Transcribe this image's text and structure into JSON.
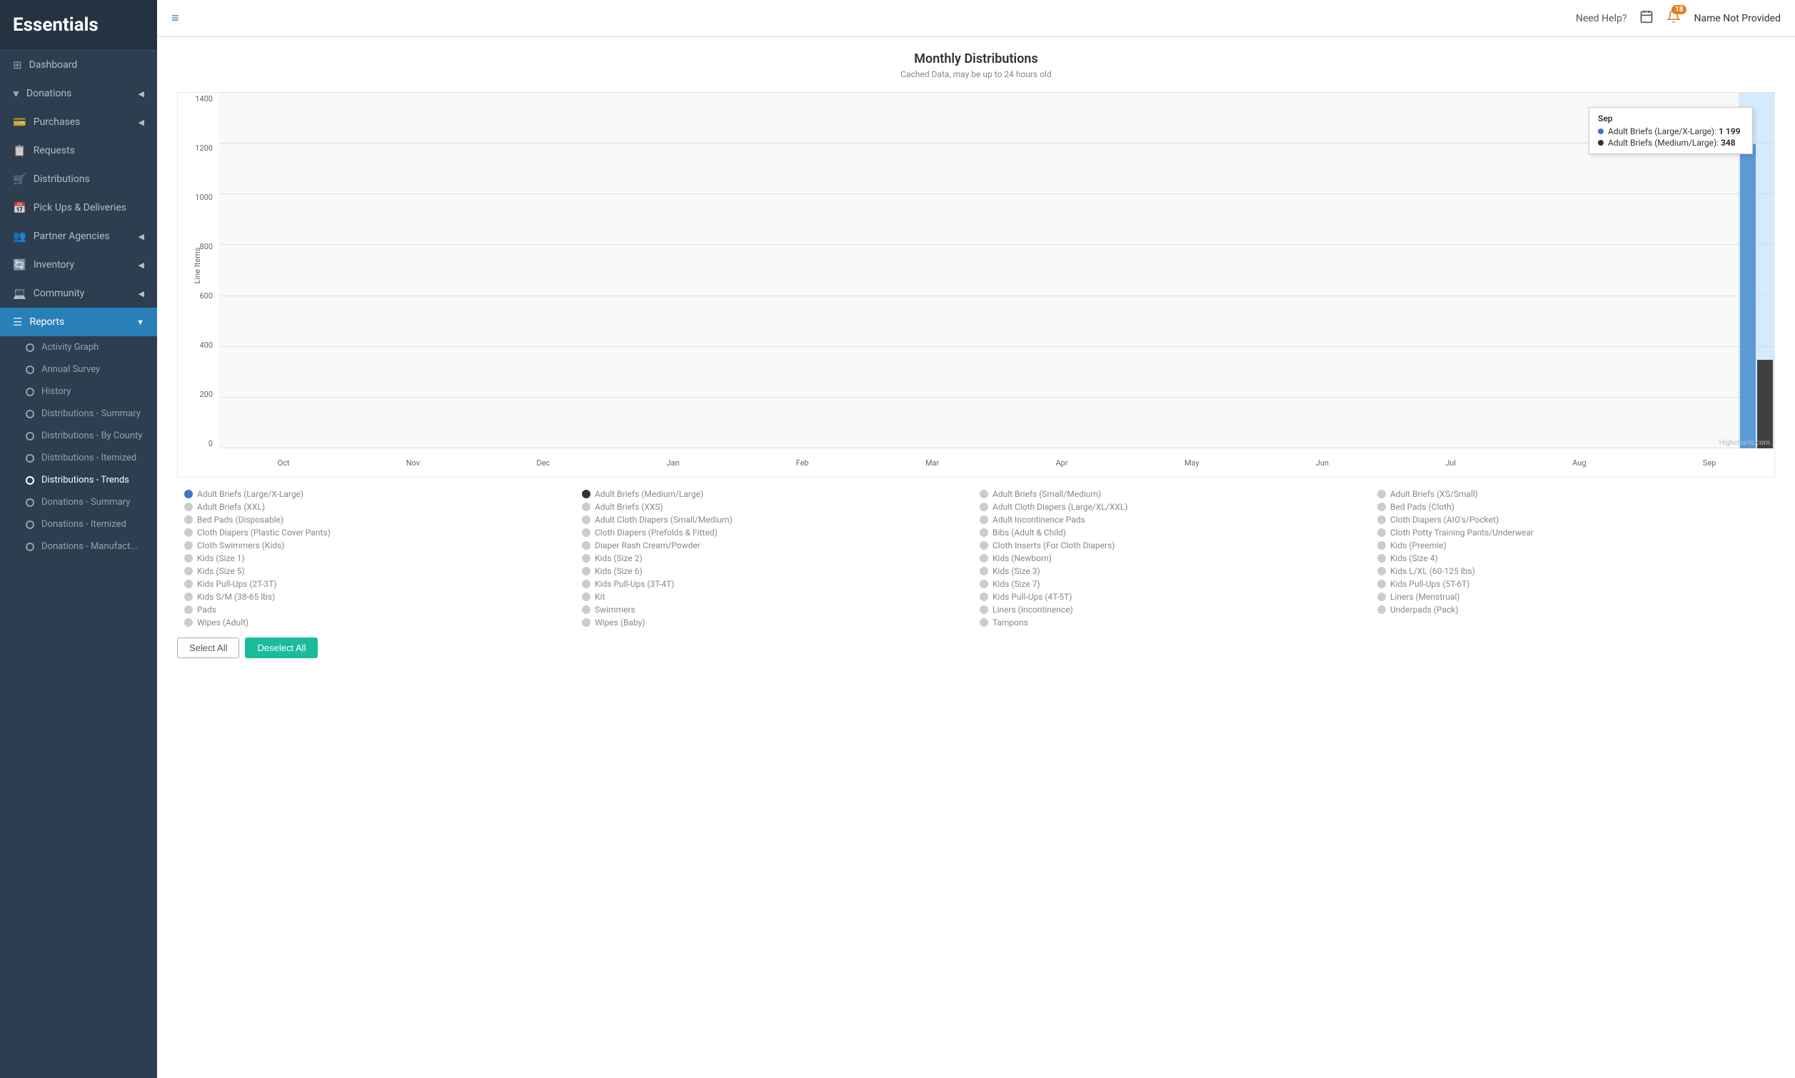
{
  "brand": "Essentials",
  "topbar": {
    "hamburger_icon": "≡",
    "help_text": "Need Help?",
    "calendar_icon": "📅",
    "bell_icon": "🔔",
    "notification_count": "18",
    "username": "Name Not Provided"
  },
  "sidebar": {
    "items": [
      {
        "id": "dashboard",
        "label": "Dashboard",
        "icon": "⊞",
        "has_chevron": false,
        "active": false
      },
      {
        "id": "donations",
        "label": "Donations",
        "icon": "♥",
        "has_chevron": true,
        "active": false
      },
      {
        "id": "purchases",
        "label": "Purchases",
        "icon": "💳",
        "has_chevron": true,
        "active": false
      },
      {
        "id": "requests",
        "label": "Requests",
        "icon": "📋",
        "has_chevron": false,
        "active": false
      },
      {
        "id": "distributions",
        "label": "Distributions",
        "icon": "🛒",
        "has_chevron": false,
        "active": false
      },
      {
        "id": "pickups",
        "label": "Pick Ups & Deliveries",
        "icon": "📅",
        "has_chevron": false,
        "active": false
      },
      {
        "id": "partner-agencies",
        "label": "Partner Agencies",
        "icon": "👥",
        "has_chevron": true,
        "active": false
      },
      {
        "id": "inventory",
        "label": "Inventory",
        "icon": "🔄",
        "has_chevron": true,
        "active": false
      },
      {
        "id": "community",
        "label": "Community",
        "icon": "💻",
        "has_chevron": true,
        "active": false
      },
      {
        "id": "reports",
        "label": "Reports",
        "icon": "☰",
        "has_chevron": true,
        "active": true
      }
    ],
    "report_subitems": [
      {
        "id": "activity-graph",
        "label": "Activity Graph",
        "active": false
      },
      {
        "id": "annual-survey",
        "label": "Annual Survey",
        "active": false
      },
      {
        "id": "history",
        "label": "History",
        "active": false
      },
      {
        "id": "dist-summary",
        "label": "Distributions - Summary",
        "active": false
      },
      {
        "id": "dist-county",
        "label": "Distributions - By County",
        "active": false
      },
      {
        "id": "dist-itemized",
        "label": "Distributions - Itemized",
        "active": false
      },
      {
        "id": "dist-trends",
        "label": "Distributions - Trends",
        "active": true
      },
      {
        "id": "donations-summary",
        "label": "Donations - Summary",
        "active": false
      },
      {
        "id": "donations-itemized",
        "label": "Donations - Itemized",
        "active": false
      },
      {
        "id": "donations-manufact",
        "label": "Donations - Manufact...",
        "active": false
      }
    ]
  },
  "chart": {
    "title": "Monthly Distributions",
    "subtitle": "Cached Data, may be up to 24 hours old",
    "y_axis_title": "Line Items",
    "y_labels": [
      "0",
      "200",
      "400",
      "600",
      "800",
      "1000",
      "1200",
      "1400"
    ],
    "x_labels": [
      "Oct",
      "Nov",
      "Dec",
      "Jan",
      "Feb",
      "Mar",
      "Apr",
      "May",
      "Jun",
      "Jul",
      "Aug",
      "Sep"
    ],
    "tooltip": {
      "month": "Sep",
      "rows": [
        {
          "label": "Adult Briefs (Large/X-Large):",
          "value": "1 199",
          "color": "#4472c4"
        },
        {
          "label": "Adult Briefs (Medium/Large):",
          "value": "348",
          "color": "#333"
        }
      ]
    },
    "highcharts_label": "Highcharts.com"
  },
  "legend": {
    "items": [
      {
        "label": "Adult Briefs (Large/X-Large)",
        "filled": true,
        "color": "#4472c4"
      },
      {
        "label": "Adult Briefs (Medium/Large)",
        "filled": true,
        "color": "#333"
      },
      {
        "label": "Adult Briefs (Small/Medium)",
        "filled": false
      },
      {
        "label": "Adult Briefs (XS/Small)",
        "filled": false
      },
      {
        "label": "Adult Briefs (XXL)",
        "filled": false
      },
      {
        "label": "Adult Briefs (XXS)",
        "filled": false
      },
      {
        "label": "Adult Cloth Diapers (Large/XL/XXL)",
        "filled": false
      },
      {
        "label": "Bed Pads (Cloth)",
        "filled": false
      },
      {
        "label": "Bed Pads (Disposable)",
        "filled": false
      },
      {
        "label": "Adult Cloth Diapers (Small/Medium)",
        "filled": false
      },
      {
        "label": "Adult Incontinence Pads",
        "filled": false
      },
      {
        "label": "Cloth Diapers (AIO's/Pocket)",
        "filled": false
      },
      {
        "label": "Cloth Diapers (Plastic Cover Pants)",
        "filled": false
      },
      {
        "label": "Cloth Diapers (Prefolds & Fitted)",
        "filled": false
      },
      {
        "label": "Bibs (Adult & Child)",
        "filled": false
      },
      {
        "label": "Cloth Potty Training Pants/Underwear",
        "filled": false
      },
      {
        "label": "Cloth Swimmers (Kids)",
        "filled": false
      },
      {
        "label": "Diaper Rash Cream/Powder",
        "filled": false
      },
      {
        "label": "Cloth Inserts (For Cloth Diapers)",
        "filled": false
      },
      {
        "label": "Kids (Preemie)",
        "filled": false
      },
      {
        "label": "Kids (Size 1)",
        "filled": false
      },
      {
        "label": "Kids (Size 2)",
        "filled": false
      },
      {
        "label": "Kids (Newborn)",
        "filled": false
      },
      {
        "label": "Kids (Size 4)",
        "filled": false
      },
      {
        "label": "Kids (Size 5)",
        "filled": false
      },
      {
        "label": "Kids (Size 6)",
        "filled": false
      },
      {
        "label": "Kids (Size 3)",
        "filled": false
      },
      {
        "label": "Kids L/XL (60-125 lbs)",
        "filled": false
      },
      {
        "label": "Kids Pull-Ups (2T-3T)",
        "filled": false
      },
      {
        "label": "Kids Pull-Ups (3T-4T)",
        "filled": false
      },
      {
        "label": "Kids (Size 7)",
        "filled": false
      },
      {
        "label": "Kids Pull-Ups (5T-6T)",
        "filled": false
      },
      {
        "label": "Kids S/M (38-65 lbs)",
        "filled": false
      },
      {
        "label": "Kit",
        "filled": false
      },
      {
        "label": "Kids Pull-Ups (4T-5T)",
        "filled": false
      },
      {
        "label": "Liners (Menstrual)",
        "filled": false
      },
      {
        "label": "Pads",
        "filled": false
      },
      {
        "label": "Swimmers",
        "filled": false
      },
      {
        "label": "Liners (Incontinence)",
        "filled": false
      },
      {
        "label": "Underpads (Pack)",
        "filled": false
      },
      {
        "label": "Wipes (Adult)",
        "filled": false
      },
      {
        "label": "Wipes (Baby)",
        "filled": false
      },
      {
        "label": "Tampons",
        "filled": false
      }
    ]
  },
  "buttons": {
    "select_all": "Select All",
    "deselect_all": "Deselect All"
  }
}
